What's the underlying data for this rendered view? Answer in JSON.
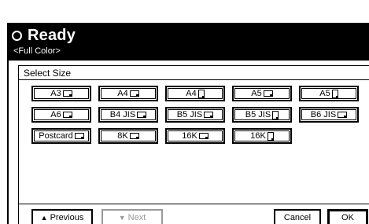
{
  "status": {
    "title": "Ready",
    "mode": "<Full Color>"
  },
  "panel": {
    "title": "Select Size"
  },
  "sizes": [
    {
      "label": "A3",
      "orient": "landscape"
    },
    {
      "label": "A4",
      "orient": "landscape"
    },
    {
      "label": "A4",
      "orient": "portrait"
    },
    {
      "label": "A5",
      "orient": "landscape"
    },
    {
      "label": "A5",
      "orient": "portrait"
    },
    {
      "label": "A6",
      "orient": "landscape"
    },
    {
      "label": "B4 JIS",
      "orient": "landscape"
    },
    {
      "label": "B5 JIS",
      "orient": "landscape"
    },
    {
      "label": "B5 JIS",
      "orient": "portrait"
    },
    {
      "label": "B6 JIS",
      "orient": "landscape"
    },
    {
      "label": "Postcard",
      "orient": "landscape"
    },
    {
      "label": "8K",
      "orient": "landscape"
    },
    {
      "label": "16K",
      "orient": "landscape"
    },
    {
      "label": "16K",
      "orient": "portrait"
    }
  ],
  "nav": {
    "previous_label": "Previous",
    "next_label": "Next",
    "cancel_label": "Cancel",
    "ok_label": "OK"
  }
}
